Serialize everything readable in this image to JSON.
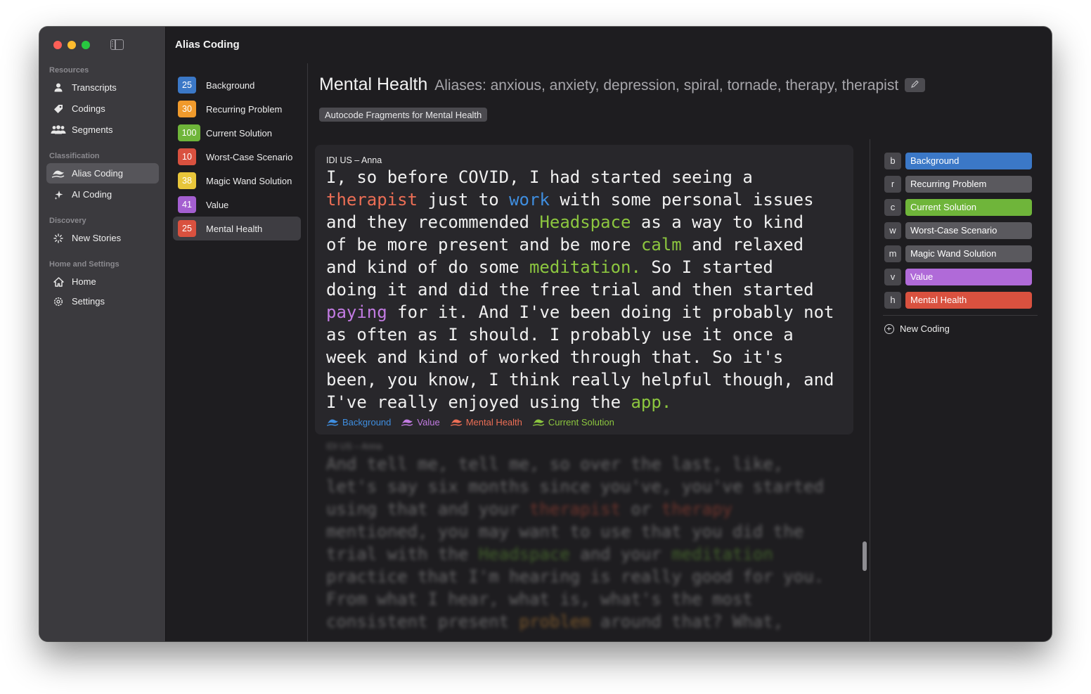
{
  "app": {
    "title": "Alias Coding"
  },
  "sidebar": {
    "sections": [
      {
        "title": "Resources",
        "items": [
          {
            "label": "Transcripts",
            "icon": "person-icon"
          },
          {
            "label": "Codings",
            "icon": "tag-icon"
          },
          {
            "label": "Segments",
            "icon": "people-icon"
          }
        ]
      },
      {
        "title": "Classification",
        "items": [
          {
            "label": "Alias Coding",
            "icon": "alias-icon",
            "active": true
          },
          {
            "label": "AI Coding",
            "icon": "sparkle-icon"
          }
        ]
      },
      {
        "title": "Discovery",
        "items": [
          {
            "label": "New Stories",
            "icon": "loader-icon"
          }
        ]
      },
      {
        "title": "Home and Settings",
        "items": [
          {
            "label": "Home",
            "icon": "house-icon"
          },
          {
            "label": "Settings",
            "icon": "gear-icon"
          }
        ]
      }
    ]
  },
  "codings": [
    {
      "count": "25",
      "label": "Background",
      "color": "#3b78c7"
    },
    {
      "count": "30",
      "label": "Recurring Problem",
      "color": "#f09a2c"
    },
    {
      "count": "100",
      "label": "Current Solution",
      "color": "#6fb53a"
    },
    {
      "count": "10",
      "label": "Worst-Case Scenario",
      "color": "#d9513f"
    },
    {
      "count": "38",
      "label": "Magic Wand Solution",
      "color": "#e8c63a"
    },
    {
      "count": "41",
      "label": "Value",
      "color": "#a45fd0"
    },
    {
      "count": "25",
      "label": "Mental Health",
      "color": "#d9513f",
      "selected": true
    }
  ],
  "main": {
    "title": "Mental Health",
    "aliases": "Aliases: anxious, anxiety, depression, spiral, tornade, therapy, therapist",
    "autocode_label": "Autocode Fragments for Mental Health",
    "fragment": {
      "source": "IDI US – Anna",
      "text_lines": [
        "I, so before COVID, I had started seeing a",
        "therapist just to work with some personal issues",
        "and they recommended Headspace as a way to kind",
        "of be more present and be more calm and relaxed",
        "and kind of do some meditation. So I started",
        "doing it and did the free trial and then started",
        "paying for it. And I've been doing it probably not",
        "as often as I should. I probably use it once a",
        "week and kind of worked through that. So it's",
        "been, you know, I think really helpful though, and",
        "I've really enjoyed using the app."
      ],
      "tags": [
        {
          "label": "Background",
          "color": "#3f8ee0"
        },
        {
          "label": "Value",
          "color": "#c27be2"
        },
        {
          "label": "Mental Health",
          "color": "#ec6e55"
        },
        {
          "label": "Current Solution",
          "color": "#8cc63f"
        }
      ]
    },
    "next_fragment": {
      "source": "IDI US – Anna",
      "text_lines": [
        "And tell me, tell me, so over the last, like,",
        "let's say six months since you've, you've started",
        "using that and your therapist or therapy",
        "mentioned, you may want to use that you did the",
        "trial with the Headspace and your meditation",
        "practice that I'm hearing is really good for you.",
        "From what I hear, what is, what's the most",
        "consistent present problem around that? What,"
      ]
    }
  },
  "shortcuts": [
    {
      "key": "b",
      "label": "Background",
      "color": "#3b78c7"
    },
    {
      "key": "r",
      "label": "Recurring Problem",
      "color": "#5a595e"
    },
    {
      "key": "c",
      "label": "Current Solution",
      "color": "#6fb53a"
    },
    {
      "key": "w",
      "label": "Worst-Case Scenario",
      "color": "#5a595e"
    },
    {
      "key": "m",
      "label": "Magic Wand Solution",
      "color": "#5a595e"
    },
    {
      "key": "v",
      "label": "Value",
      "color": "#b06ad8"
    },
    {
      "key": "h",
      "label": "Mental Health",
      "color": "#d9513f"
    }
  ],
  "new_coding_label": "New Coding"
}
